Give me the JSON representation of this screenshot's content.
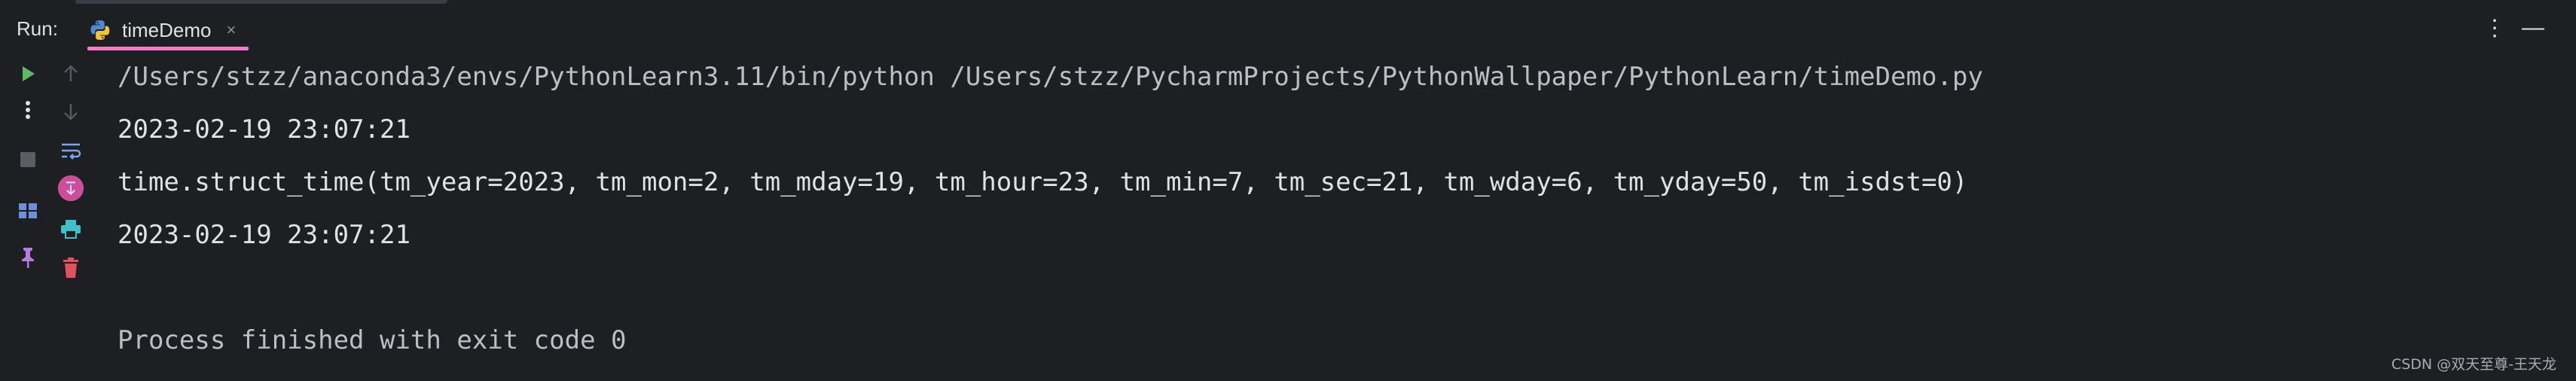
{
  "run_bar": {
    "run_label": "Run:",
    "tab_label": "timeDemo",
    "tab_close": "×",
    "more_icon": "⋮",
    "minimize_icon": "—"
  },
  "console": {
    "lines": [
      "/Users/stzz/anaconda3/envs/PythonLearn3.11/bin/python /Users/stzz/PycharmProjects/PythonWallpaper/PythonLearn/timeDemo.py",
      "2023-02-19 23:07:21",
      "time.struct_time(tm_year=2023, tm_mon=2, tm_mday=19, tm_hour=23, tm_min=7, tm_sec=21, tm_wday=6, tm_yday=50, tm_isdst=0)",
      "2023-02-19 23:07:21",
      "",
      "Process finished with exit code 0"
    ]
  },
  "watermark": "CSDN @双天至尊-王天龙",
  "icons": [
    "play-icon",
    "more-vertical-icon",
    "stop-icon",
    "layout-icon",
    "pin-icon",
    "arrow-up-icon",
    "arrow-down-icon",
    "soft-wrap-icon",
    "scroll-to-end-icon",
    "print-icon",
    "trash-icon"
  ],
  "colors": {
    "background": "#1e1f22",
    "text": "#dfe1e5",
    "run_green": "#5fb865",
    "tab_underline": "#f07ec8",
    "trash_red": "#e0525e",
    "print_teal": "#3fc1c9",
    "scroll_pink": "#c94f9a"
  }
}
